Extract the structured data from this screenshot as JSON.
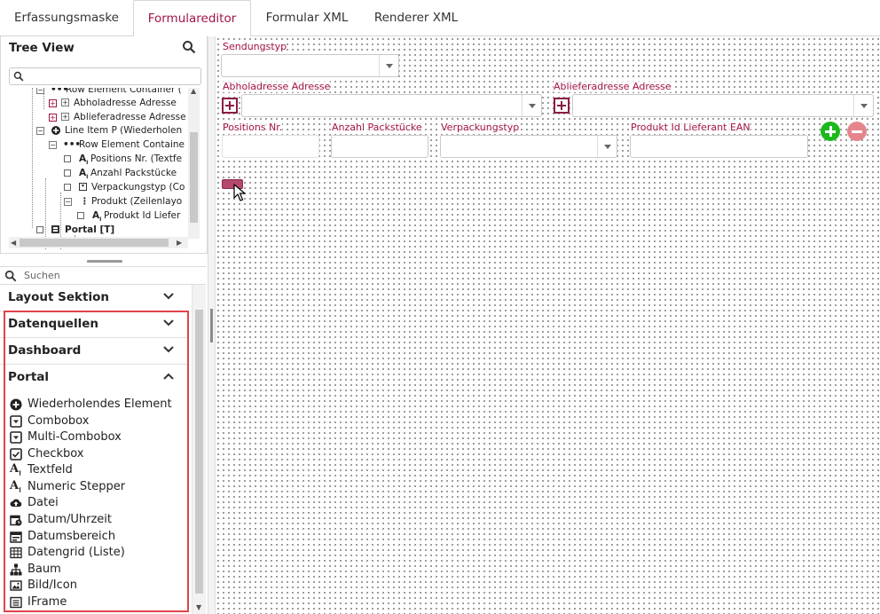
{
  "tabs": [
    "Erfassungsmaske",
    "Formulareditor",
    "Formular XML",
    "Renderer XML"
  ],
  "active_tab": "Formulareditor",
  "tree": {
    "title": "Tree View",
    "rows": [
      "Row Element Container (",
      "Abholadresse Adresse",
      "Ablieferadresse Adresse",
      "Line Item P (Wiederholen",
      "Row Element Containe",
      "Positions Nr. (Textfe",
      "Anzahl Packstücke",
      "Verpackungstyp (Co",
      "Produkt (Zeilenlayo",
      "Produkt Id Liefer",
      "Portal [T]"
    ]
  },
  "palette": {
    "search_placeholder": "Suchen",
    "sections": [
      "Layout Sektion",
      "Datenquellen",
      "Dashboard",
      "Portal"
    ],
    "portal_items": [
      {
        "label": "Wiederholendes Element",
        "icon": "plus-circle-icon"
      },
      {
        "label": "Combobox",
        "icon": "dropdown-icon"
      },
      {
        "label": "Multi-Combobox",
        "icon": "dropdown-icon"
      },
      {
        "label": "Checkbox",
        "icon": "checkbox-icon"
      },
      {
        "label": "Textfeld",
        "icon": "text-icon"
      },
      {
        "label": "Numeric Stepper",
        "icon": "text-icon"
      },
      {
        "label": "Datei",
        "icon": "cloud-upload-icon"
      },
      {
        "label": "Datum/Uhrzeit",
        "icon": "calendar-clock-icon"
      },
      {
        "label": "Datumsbereich",
        "icon": "calendar-range-icon"
      },
      {
        "label": "Datengrid (Liste)",
        "icon": "grid-icon"
      },
      {
        "label": "Baum",
        "icon": "tree-icon"
      },
      {
        "label": "Bild/Icon",
        "icon": "image-icon"
      },
      {
        "label": "IFrame",
        "icon": "iframe-icon"
      }
    ]
  },
  "canvas": {
    "sendungstyp_label": "Sendungstyp",
    "abholadresse_label": "Abholadresse Adresse",
    "ablieferadresse_label": "Ablieferadresse Adresse",
    "positions_label": "Positions Nr.",
    "anzahl_label": "Anzahl Packstücke",
    "verpackung_label": "Verpackungstyp",
    "produkt_label": "Produkt Id Lieferant EAN"
  },
  "colors": {
    "accent": "#a3124a",
    "highlight": "#e0444c",
    "add": "#1bb91b",
    "remove": "#e6848c"
  }
}
